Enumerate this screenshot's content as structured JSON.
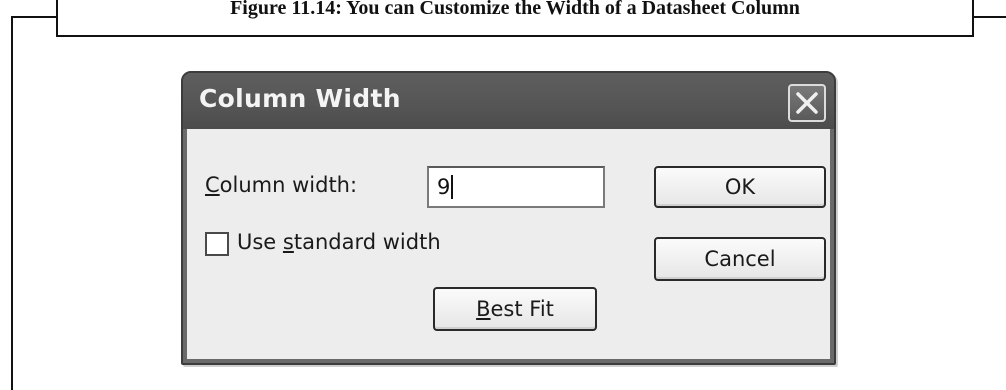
{
  "figure": {
    "caption": "Figure 11.14: You can Customize the Width of a Datasheet Column"
  },
  "dialog": {
    "title": "Column Width",
    "close_icon": "close-icon",
    "column_width_label_prefix": "C",
    "column_width_label_rest": "olumn width:",
    "column_width_value": "9",
    "use_standard_prefix": "Use ",
    "use_standard_u": "s",
    "use_standard_rest": "tandard width",
    "use_standard_checked": false,
    "ok_label": "OK",
    "cancel_label": "Cancel",
    "best_fit_u": "B",
    "best_fit_rest": "est Fit"
  },
  "colors": {
    "titlebar": "#555555",
    "client": "#ededed",
    "title_text": "#f4f4f4"
  }
}
